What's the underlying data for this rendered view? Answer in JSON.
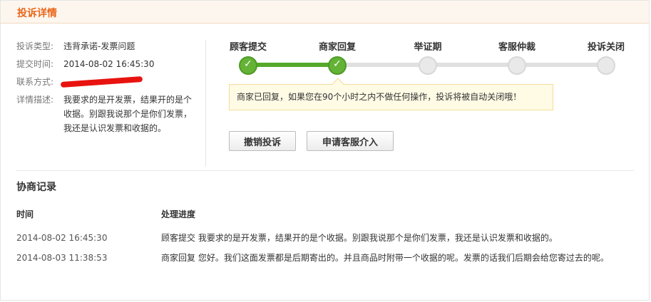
{
  "header": {
    "title": "投诉详情"
  },
  "info": {
    "type_label": "投诉类型:",
    "type_value": "违背承诺-发票问题",
    "time_label": "提交时间:",
    "time_value": "2014-08-02 16:45:30",
    "contact_label": "联系方式:",
    "desc_label": "详情描述:",
    "desc_value": "我要求的是开发票，结果开的是个收据。别跟我说那个是你们发票，我还是认识发票和收据的。"
  },
  "steps": [
    {
      "label": "顾客提交",
      "status": "done"
    },
    {
      "label": "商家回复",
      "status": "done"
    },
    {
      "label": "举证期",
      "status": "pending"
    },
    {
      "label": "客服仲裁",
      "status": "pending"
    },
    {
      "label": "投诉关闭",
      "status": "pending"
    }
  ],
  "notice": "商家已回复，如果您在90个小时之内不做任何操作，投诉将被自动关闭哦！",
  "buttons": {
    "cancel": "撤销投诉",
    "service": "申请客服介入"
  },
  "records": {
    "title": "协商记录",
    "columns": {
      "time": "时间",
      "progress": "处理进度"
    },
    "rows": [
      {
        "time": "2014-08-02 16:45:30",
        "text": "顾客提交  我要求的是开发票，结果开的是个收据。别跟我说那个是你们发票，我还是认识发票和收据的。"
      },
      {
        "time": "2014-08-03 11:38:53",
        "text": "商家回复  您好。我们这面发票都是后期寄出的。并且商品时附带一个收据的呢。发票的话我们后期会给您寄过去的呢。"
      }
    ]
  },
  "colors": {
    "accent": "#e8661c",
    "progress": "#64b336",
    "notice_bg": "#fffbe5",
    "redaction": "#e8130f"
  }
}
